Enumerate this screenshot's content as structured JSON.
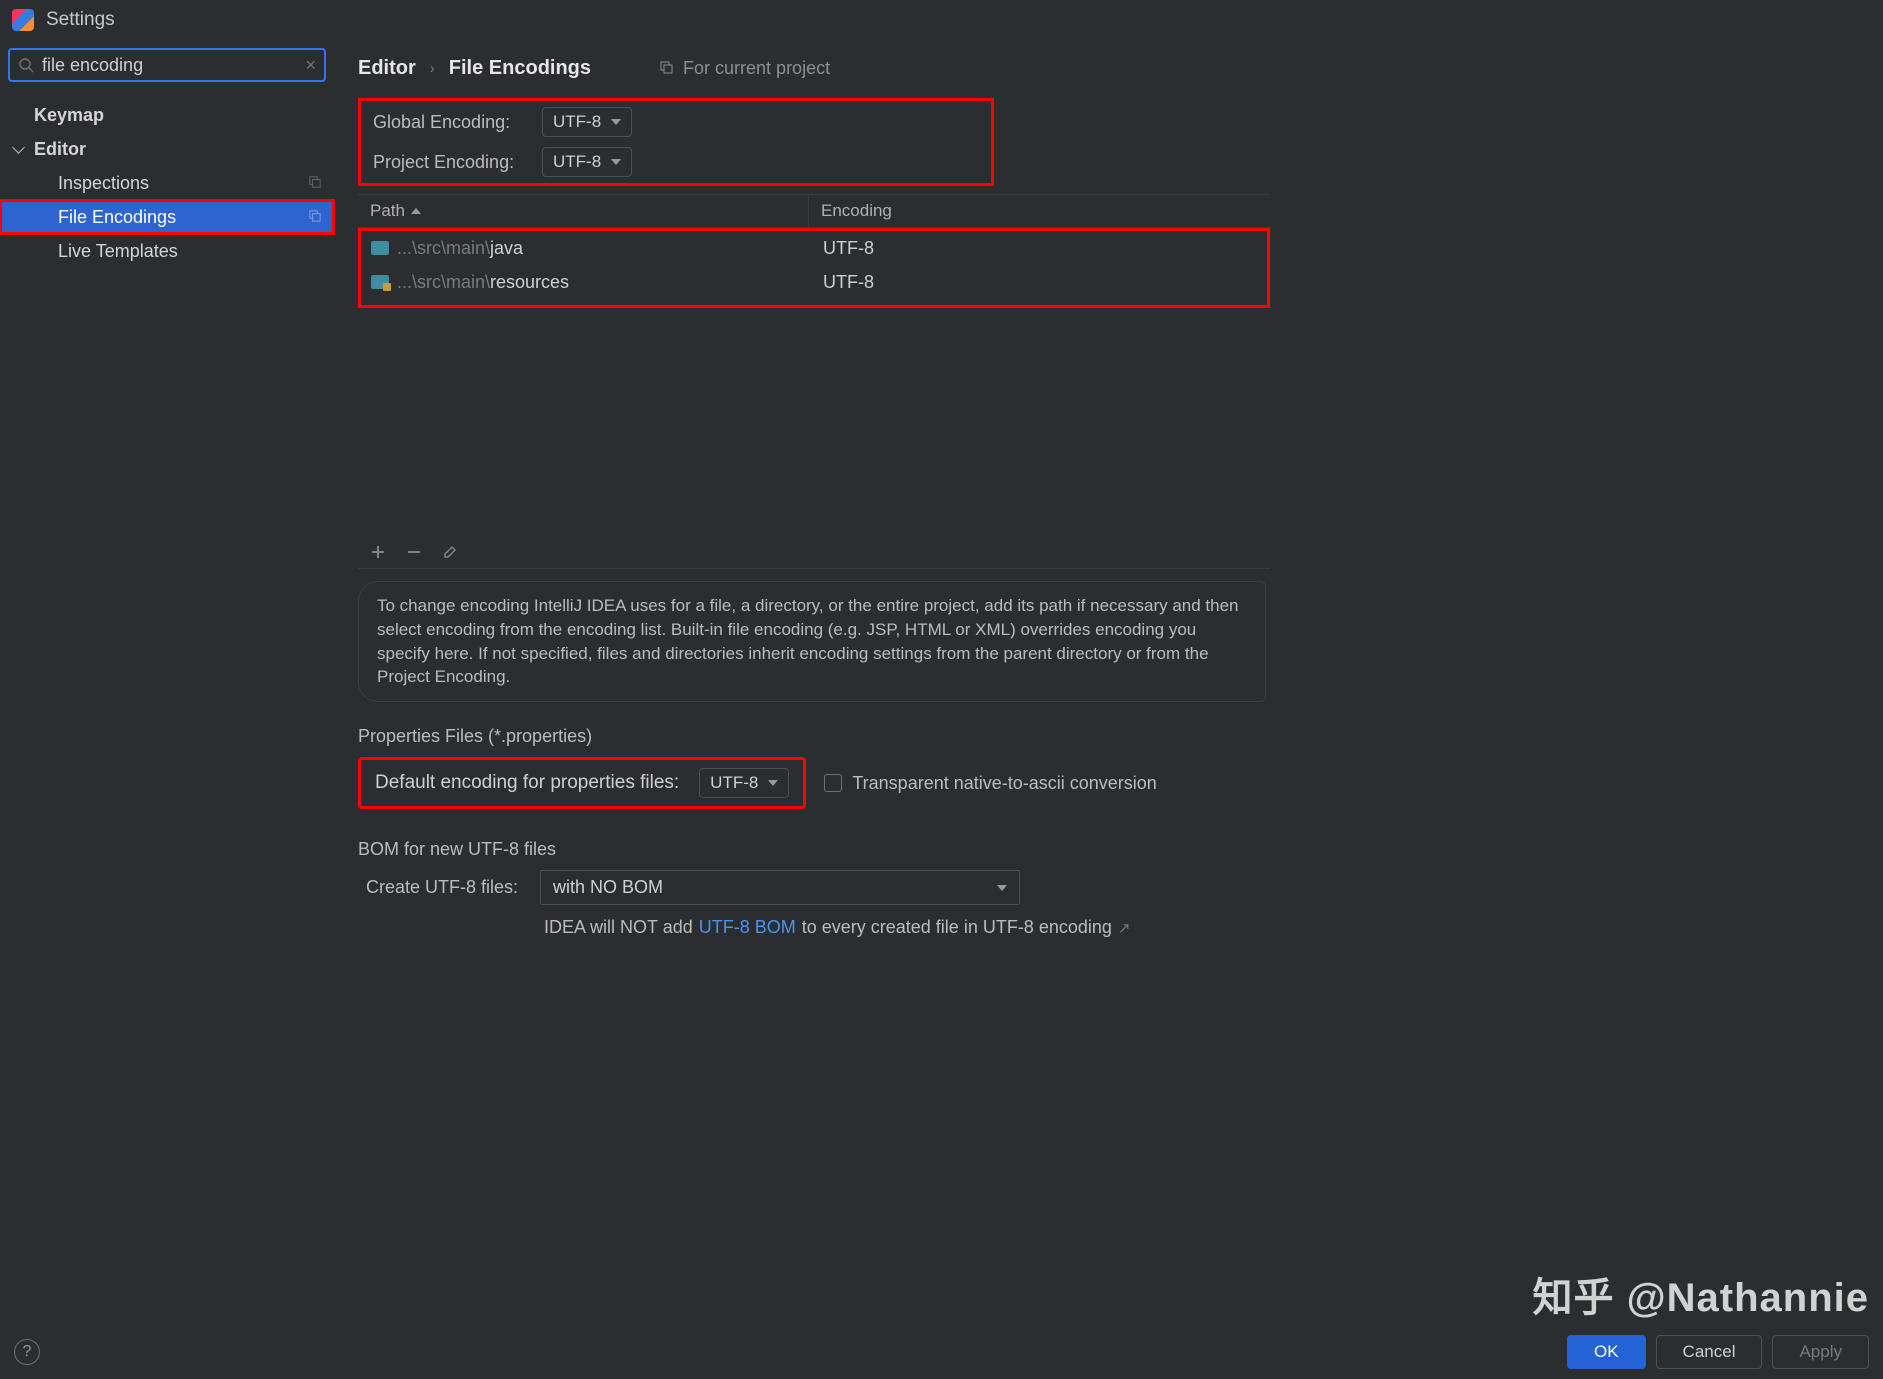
{
  "title": "Settings",
  "search": {
    "value": "file encoding"
  },
  "sidebar": {
    "keymap": "Keymap",
    "editor": "Editor",
    "items": [
      "Inspections",
      "File Encodings",
      "Live Templates"
    ]
  },
  "crumbs": {
    "a": "Editor",
    "b": "File Encodings",
    "scope": "For current project"
  },
  "encodings": {
    "globalLabel": "Global Encoding:",
    "globalValue": "UTF-8",
    "projectLabel": "Project Encoding:",
    "projectValue": "UTF-8"
  },
  "table": {
    "colPath": "Path",
    "colEnc": "Encoding",
    "rows": [
      {
        "prefix": "...\\src\\main\\",
        "name": "java",
        "enc": "UTF-8"
      },
      {
        "prefix": "...\\src\\main\\",
        "name": "resources",
        "enc": "UTF-8"
      }
    ]
  },
  "info": "To change encoding IntelliJ IDEA uses for a file, a directory, or the entire project, add its path if necessary and then select encoding from the encoding list. Built-in file encoding (e.g. JSP, HTML or XML) overrides encoding you specify here. If not specified, files and directories inherit encoding settings from the parent directory or from the Project Encoding.",
  "props": {
    "section": "Properties Files (*.properties)",
    "defaultLabel": "Default encoding for properties files:",
    "defaultValue": "UTF-8",
    "transparent": "Transparent native-to-ascii conversion"
  },
  "bom": {
    "section": "BOM for new UTF-8 files",
    "createLabel": "Create UTF-8 files:",
    "createValue": "with NO BOM",
    "note1": "IDEA will NOT add ",
    "link": "UTF-8 BOM",
    "note2": " to every created file in UTF-8 encoding"
  },
  "footer": {
    "ok": "OK",
    "cancel": "Cancel",
    "apply": "Apply"
  },
  "watermark": "知乎 @Nathannie"
}
